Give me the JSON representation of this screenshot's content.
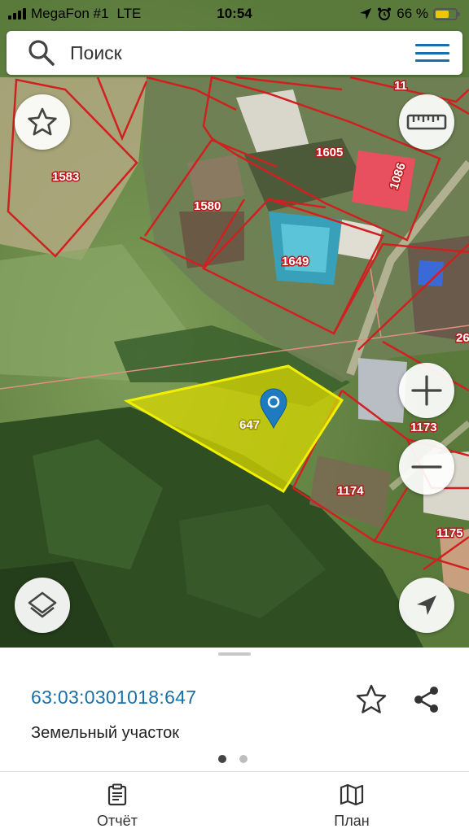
{
  "status_bar": {
    "carrier": "MegaFon #1",
    "network": "LTE",
    "time": "10:54",
    "battery_text": "66 %",
    "battery_level": 0.66,
    "battery_color": "#f5c400"
  },
  "search": {
    "placeholder": "Поиск",
    "search_icon": "search-icon",
    "menu_icon": "hamburger-menu-icon",
    "accent_color": "#1a6fa8"
  },
  "map": {
    "parcels": [
      "1583",
      "1605",
      "1086",
      "1580",
      "1649",
      "1173",
      "1174",
      "1175",
      "11",
      "26"
    ],
    "selected_parcel_label": "647",
    "selected_fill_color": "#d8d800",
    "boundary_color": "#d02020"
  },
  "map_controls": {
    "favorite_icon": "star-outline-icon",
    "ruler_icon": "ruler-icon",
    "zoom_in_icon": "plus-icon",
    "zoom_out_icon": "minus-icon",
    "layers_icon": "layers-icon",
    "locate_icon": "navigation-arrow-icon"
  },
  "details": {
    "cadastral_number": "63:03:0301018:647",
    "parcel_type": "Земельный участок",
    "page_count": 2,
    "active_page": 1
  },
  "tabs": [
    {
      "label": "Отчёт",
      "icon": "report-clipboard-icon"
    },
    {
      "label": "План",
      "icon": "map-plan-icon"
    }
  ]
}
